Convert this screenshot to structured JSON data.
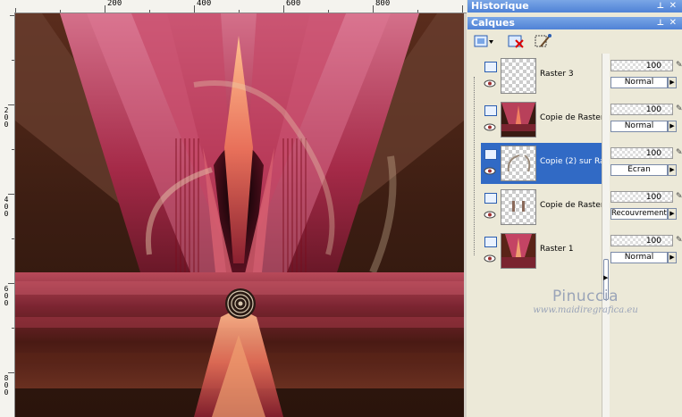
{
  "ruler": {
    "top_labels": [
      "200",
      "400",
      "600",
      "800"
    ],
    "left_labels": [
      "2 0 0",
      "4 0 0",
      "6 0 0",
      "8 0 0"
    ]
  },
  "panels": {
    "history_title": "Historique",
    "layers_title": "Calques"
  },
  "layers": [
    {
      "name": "Raster 3",
      "opacity": "100",
      "blend": "Normal",
      "selected": false
    },
    {
      "name": "Copie de Raster",
      "opacity": "100",
      "blend": "Normal",
      "selected": false
    },
    {
      "name": "Copie (2) sur Ra",
      "opacity": "100",
      "blend": "Écran",
      "selected": true
    },
    {
      "name": "Copie de Raster",
      "opacity": "100",
      "blend": "Recouvrement",
      "selected": false
    },
    {
      "name": "Raster 1",
      "opacity": "100",
      "blend": "Normal",
      "selected": false
    }
  ],
  "watermark": {
    "name": "Pinuccia",
    "url": "www.maidiregrafica.eu"
  },
  "icons": [
    "new-layer-icon",
    "delete-layer-icon",
    "layer-properties-icon",
    "pin-icon",
    "close-icon",
    "visibility-eye-icon",
    "layer-type-icon",
    "edit-icon",
    "dropdown-arrow-icon"
  ],
  "colors": {
    "selection": "#316ac5",
    "titlebar": "#4f82d6"
  }
}
